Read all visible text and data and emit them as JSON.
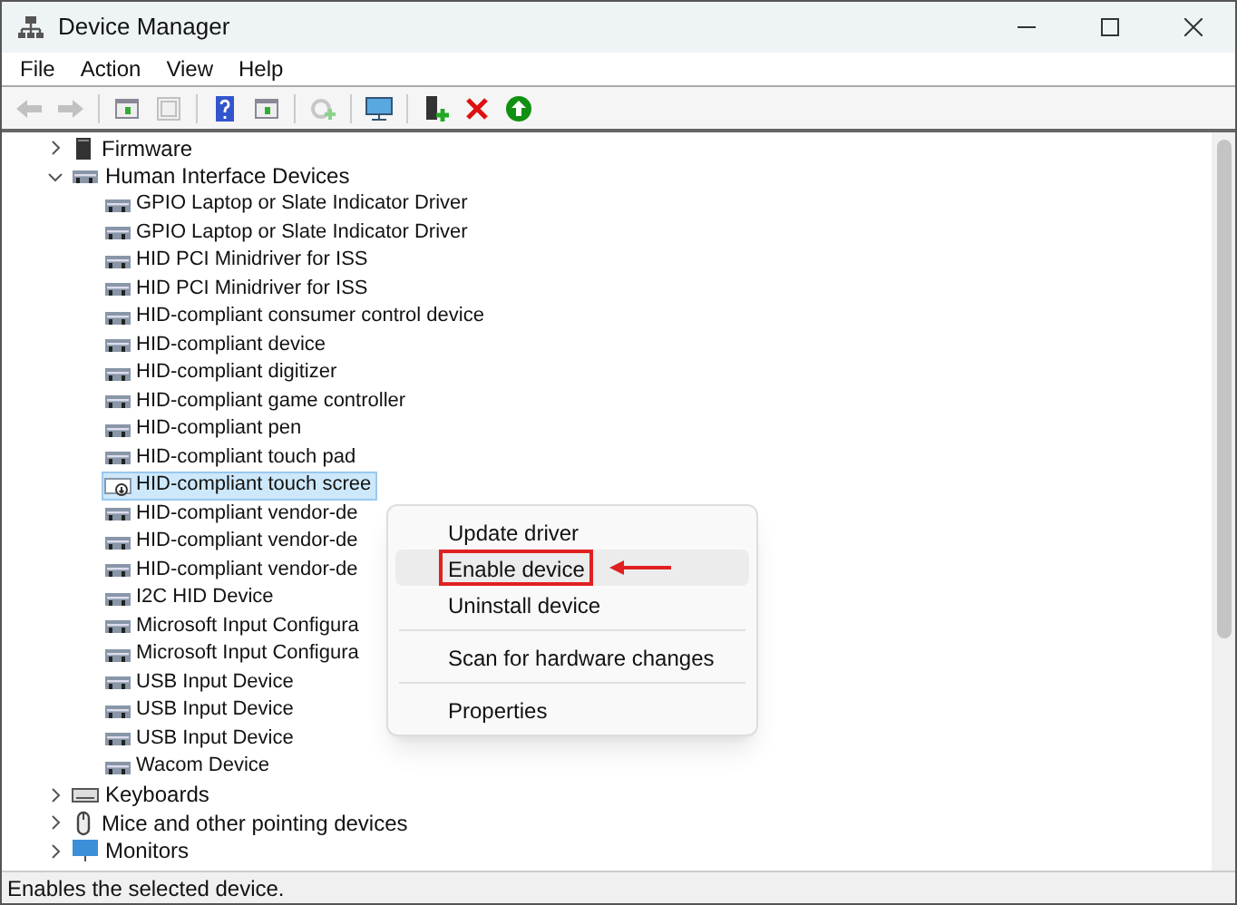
{
  "window": {
    "title": "Device Manager"
  },
  "menu_bar": [
    "File",
    "Action",
    "View",
    "Help"
  ],
  "toolbar": [
    {
      "kind": "back",
      "disabled": true
    },
    {
      "kind": "forward",
      "disabled": true
    },
    {
      "kind": "panel",
      "disabled": false
    },
    {
      "kind": "properties",
      "disabled": true
    },
    {
      "kind": "help",
      "disabled": false
    },
    {
      "kind": "panel",
      "disabled": false
    },
    {
      "kind": "update",
      "disabled": true
    },
    {
      "kind": "monitor",
      "disabled": false
    },
    {
      "kind": "add",
      "disabled": false
    },
    {
      "kind": "remove",
      "disabled": false
    },
    {
      "kind": "enable",
      "disabled": false
    }
  ],
  "tree": [
    {
      "label": "Firmware",
      "kind": "firmware",
      "expanded": false
    },
    {
      "label": "Human Interface Devices",
      "kind": "hid",
      "expanded": true,
      "children": [
        {
          "label": "GPIO Laptop or Slate Indicator Driver",
          "selected": false,
          "disabled": false
        },
        {
          "label": "GPIO Laptop or Slate Indicator Driver",
          "selected": false,
          "disabled": false
        },
        {
          "label": "HID PCI Minidriver for ISS",
          "selected": false,
          "disabled": false
        },
        {
          "label": "HID PCI Minidriver for ISS",
          "selected": false,
          "disabled": false
        },
        {
          "label": "HID-compliant consumer control device",
          "selected": false,
          "disabled": false
        },
        {
          "label": "HID-compliant device",
          "selected": false,
          "disabled": false
        },
        {
          "label": "HID-compliant digitizer",
          "selected": false,
          "disabled": false
        },
        {
          "label": "HID-compliant game controller",
          "selected": false,
          "disabled": false
        },
        {
          "label": "HID-compliant pen",
          "selected": false,
          "disabled": false
        },
        {
          "label": "HID-compliant touch pad",
          "selected": false,
          "disabled": false
        },
        {
          "label": "HID-compliant touch scree",
          "selected": true,
          "disabled": true
        },
        {
          "label": "HID-compliant vendor-de",
          "selected": false,
          "disabled": false
        },
        {
          "label": "HID-compliant vendor-de",
          "selected": false,
          "disabled": false
        },
        {
          "label": "HID-compliant vendor-de",
          "selected": false,
          "disabled": false
        },
        {
          "label": "I2C HID Device",
          "selected": false,
          "disabled": false
        },
        {
          "label": "Microsoft Input Configura",
          "selected": false,
          "disabled": false
        },
        {
          "label": "Microsoft Input Configura",
          "selected": false,
          "disabled": false
        },
        {
          "label": "USB Input Device",
          "selected": false,
          "disabled": false
        },
        {
          "label": "USB Input Device",
          "selected": false,
          "disabled": false
        },
        {
          "label": "USB Input Device",
          "selected": false,
          "disabled": false
        },
        {
          "label": "Wacom Device",
          "selected": false,
          "disabled": false
        }
      ]
    },
    {
      "label": "Keyboards",
      "kind": "keyboard",
      "expanded": false
    },
    {
      "label": "Mice and other pointing devices",
      "kind": "mouse",
      "expanded": false
    },
    {
      "label": "Monitors",
      "kind": "monitor",
      "expanded": false
    }
  ],
  "context_menu": {
    "groups": [
      [
        {
          "label": "Update driver",
          "selected": false
        },
        {
          "label": "Enable device",
          "selected": true
        },
        {
          "label": "Uninstall device",
          "selected": false
        }
      ],
      [
        {
          "label": "Scan for hardware changes",
          "selected": false
        }
      ],
      [
        {
          "label": "Properties",
          "selected": false
        }
      ]
    ]
  },
  "status_bar": "Enables the selected device."
}
